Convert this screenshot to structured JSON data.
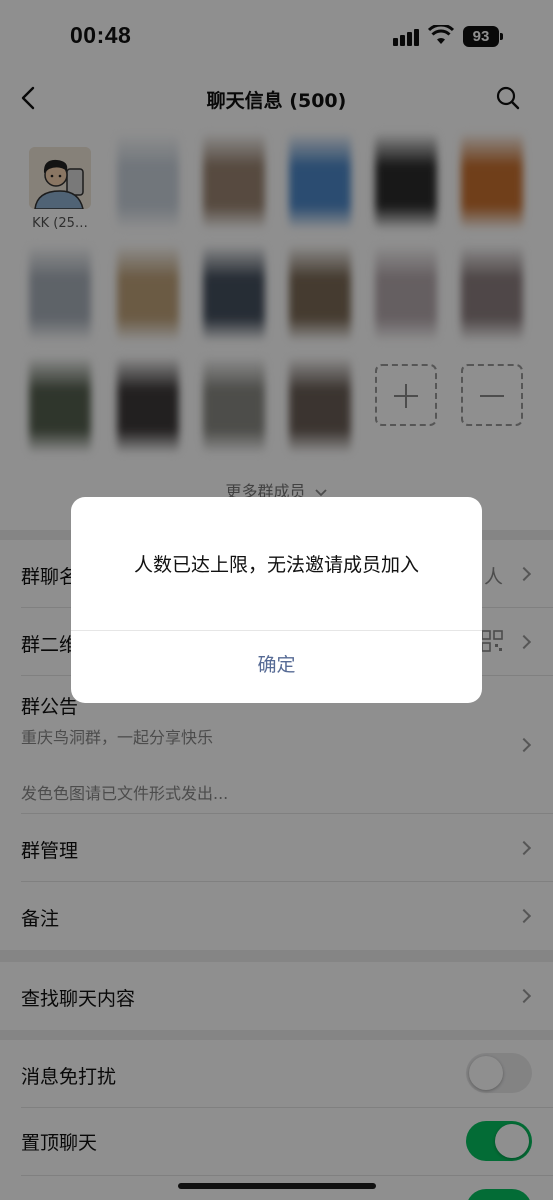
{
  "status_bar": {
    "time": "00:48",
    "battery": "93"
  },
  "nav": {
    "title": "聊天信息 (500)"
  },
  "members": {
    "first_name": "KK (25…",
    "avatar_colors": [
      "#c9d2dc",
      "#9b8572",
      "#4d88c9",
      "#2c2c2c",
      "#c8702f",
      "#a8b0ba",
      "#bfa27a",
      "#45505f",
      "#7c6a56",
      "#b5a9ad",
      "#8d7f80",
      "#55604f",
      "#3e3a3a",
      "#8a8a84",
      "#6a5e56"
    ]
  },
  "more_members": "更多群成员",
  "settings": {
    "group_name_label": "群聊名称",
    "group_name_value": "人",
    "qr_label": "群二维码",
    "notice_label": "群公告",
    "notice_line1": "重庆鸟洞群，一起分享快乐",
    "notice_line2": "发色色图请已文件形式发出...",
    "manage_label": "群管理",
    "remark_label": "备注",
    "search_label": "查找聊天内容",
    "mute_label": "消息免打扰",
    "pin_label": "置顶聊天"
  },
  "toggles": {
    "mute": false,
    "pin": true
  },
  "colors": {
    "accent_green": "#07c160",
    "link_blue": "#576b95"
  },
  "dialog": {
    "message": "人数已达上限，无法邀请成员加入",
    "confirm": "确定"
  }
}
